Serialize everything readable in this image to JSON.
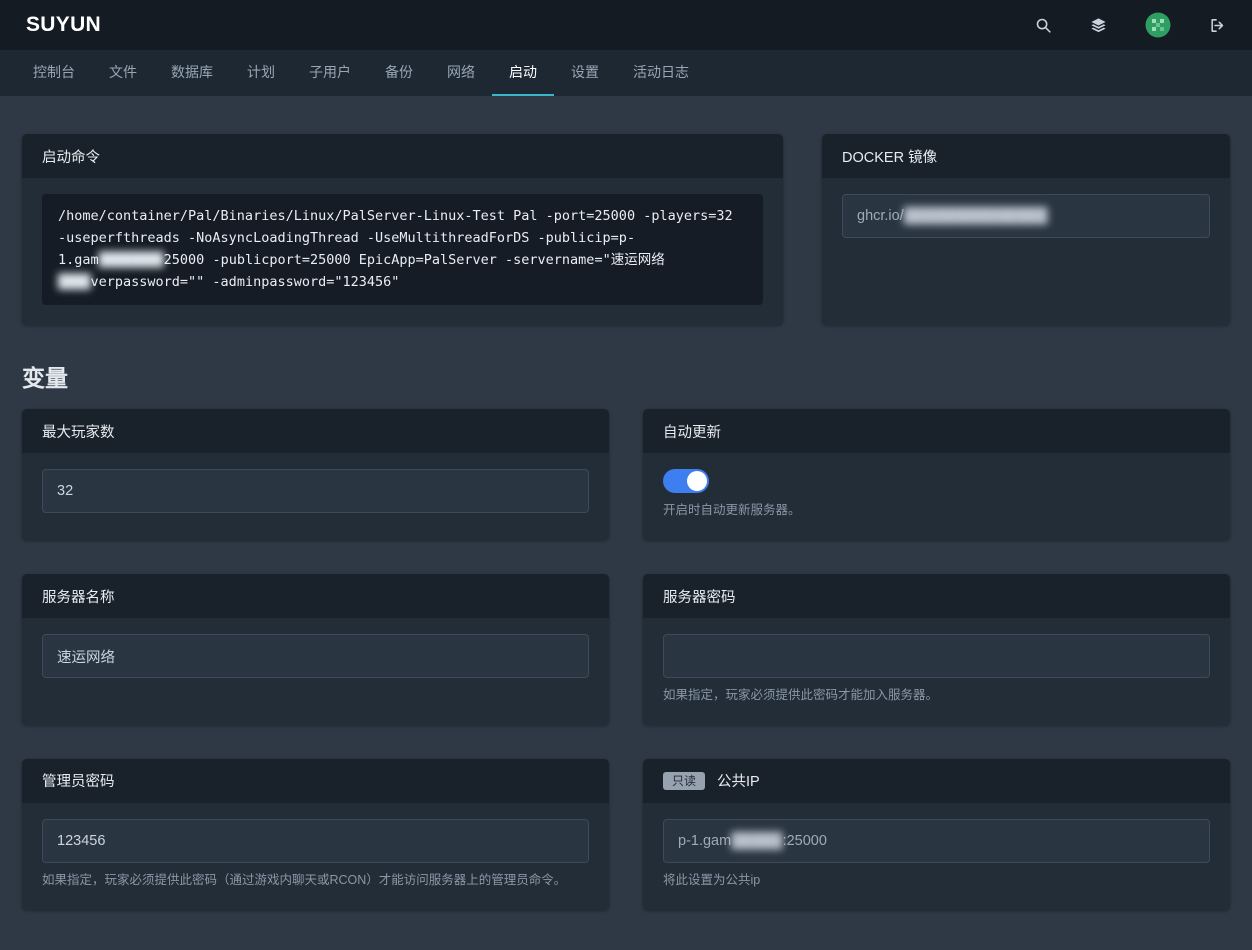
{
  "brand": "SUYUN",
  "topbar": {
    "icons": [
      "search-icon",
      "server-list-icon",
      "user-avatar",
      "logout-icon"
    ]
  },
  "nav": {
    "tabs": [
      {
        "label": "控制台",
        "active": false
      },
      {
        "label": "文件",
        "active": false
      },
      {
        "label": "数据库",
        "active": false
      },
      {
        "label": "计划",
        "active": false
      },
      {
        "label": "子用户",
        "active": false
      },
      {
        "label": "备份",
        "active": false
      },
      {
        "label": "网络",
        "active": false
      },
      {
        "label": "启动",
        "active": true
      },
      {
        "label": "设置",
        "active": false
      },
      {
        "label": "活动日志",
        "active": false
      }
    ]
  },
  "startup": {
    "title": "启动命令",
    "command_segments": [
      {
        "type": "text",
        "value": "/home/container/Pal/Binaries/Linux/PalServer-Linux-Test Pal -port=25000 -players=32 -useperfthreads -NoAsyncLoadingThread -UseMultithreadForDS -publicip=p-1.gam"
      },
      {
        "type": "redacted",
        "value": "████████"
      },
      {
        "type": "text",
        "value": "25000 -publicport=25000 EpicApp=PalServer -servername=\"速运网络"
      },
      {
        "type": "redacted",
        "value": "████"
      },
      {
        "type": "text",
        "value": "verpassword=\"\" -adminpassword=\"123456\""
      }
    ]
  },
  "docker": {
    "title": "DOCKER 镜像",
    "value_segments": [
      {
        "type": "text",
        "value": "ghcr.io/"
      },
      {
        "type": "redacted",
        "value": "██████████████"
      }
    ]
  },
  "variables": {
    "heading": "变量",
    "cards": [
      {
        "title": "最大玩家数",
        "type": "input",
        "value": "32"
      },
      {
        "title": "自动更新",
        "type": "toggle",
        "on": true,
        "description": "开启时自动更新服务器。"
      },
      {
        "title": "服务器名称",
        "type": "input",
        "value": "速运网络"
      },
      {
        "title": "服务器密码",
        "type": "input",
        "value": "",
        "description": "如果指定，玩家必须提供此密码才能加入服务器。"
      },
      {
        "title": "管理员密码",
        "type": "input",
        "value": "123456",
        "description": "如果指定，玩家必须提供此密码（通过游戏内聊天或RCON）才能访问服务器上的管理员命令。"
      },
      {
        "title": "公共IP",
        "badge": "只读",
        "type": "readonly-input",
        "value_segments": [
          {
            "type": "text",
            "value": "p-1.gam"
          },
          {
            "type": "redacted",
            "value": "█████"
          },
          {
            "type": "text",
            "value": ":25000"
          }
        ],
        "description": "将此设置为公共ip"
      }
    ],
    "accent_toggle_color": "#3d7ef0",
    "active_tab_color": "#37b6cc"
  }
}
